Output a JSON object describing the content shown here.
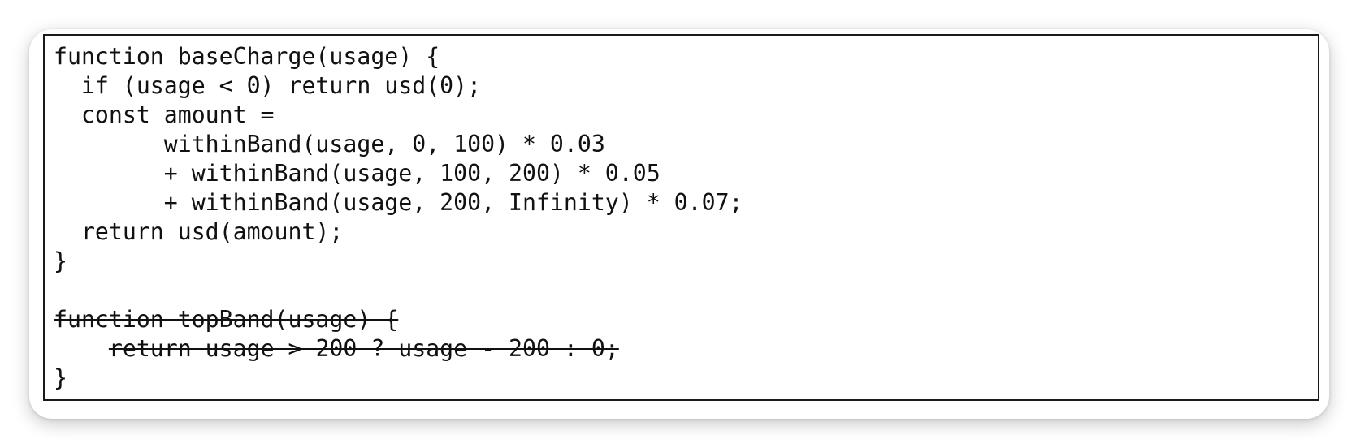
{
  "code_block": {
    "lines": [
      {
        "text": "function baseCharge(usage) {",
        "deleted": false
      },
      {
        "text": "  if (usage < 0) return usd(0);",
        "deleted": false
      },
      {
        "text": "  const amount =",
        "deleted": false
      },
      {
        "text": "        withinBand(usage, 0, 100) * 0.03",
        "deleted": false
      },
      {
        "text": "        + withinBand(usage, 100, 200) * 0.05",
        "deleted": false
      },
      {
        "text": "        + withinBand(usage, 200, Infinity) * 0.07;",
        "deleted": false
      },
      {
        "text": "  return usd(amount);",
        "deleted": false
      },
      {
        "text": "}",
        "deleted": false
      },
      {
        "text": "",
        "deleted": false
      },
      {
        "text": "function topBand(usage) {",
        "deleted": true
      },
      {
        "text": "    return usage > 200 ? usage - 200 : 0;",
        "deleted": true
      },
      {
        "text": "}",
        "deleted": false
      }
    ]
  }
}
